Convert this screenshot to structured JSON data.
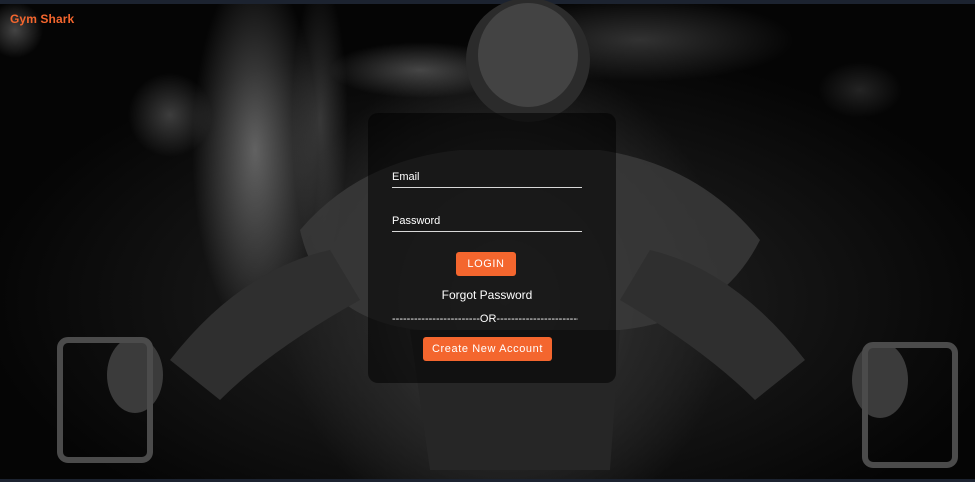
{
  "brand": {
    "name": "Gym Shark"
  },
  "login_form": {
    "email_label": "Email",
    "password_label": "Password",
    "login_button": "LOGIN",
    "forgot_password": "Forgot Password",
    "divider": "------------------------OR------------------------",
    "create_account_button": "Create New Account"
  },
  "colors": {
    "accent": "#f4662e",
    "text": "#ffffff",
    "card": "rgba(0,0,0,0.55)"
  }
}
